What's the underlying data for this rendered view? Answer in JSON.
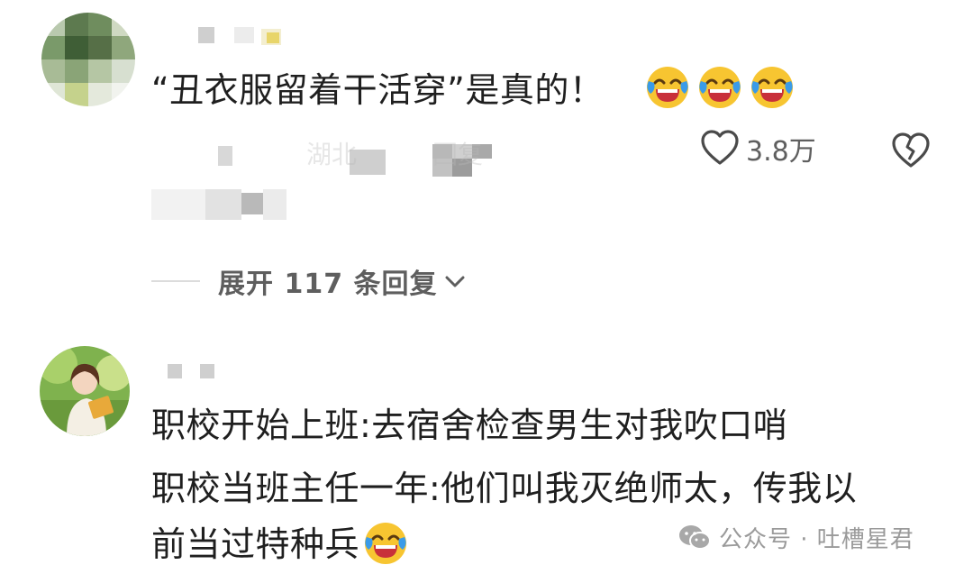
{
  "comment1": {
    "text": "“丑衣服留着干活穿”是真的！",
    "meta_fragments": [
      "湖北",
      "回复"
    ],
    "like_count": "3.8万",
    "emoji_count": 3
  },
  "replies": {
    "expand_label": "展开 117 条回复"
  },
  "comment2": {
    "lines": [
      "职校开始上班:去宿舍检查男生对我吹口哨",
      "职校当班主任一年:他们叫我灭绝师太，传我以",
      "前当过特种兵"
    ]
  },
  "watermark": {
    "text": "公众号 · 吐槽星君"
  },
  "colors": {
    "emoji_face": "#f7c531",
    "emoji_tear": "#3a9be8",
    "emoji_mouth": "#c8303a",
    "muted_text": "#5f5f5f"
  }
}
